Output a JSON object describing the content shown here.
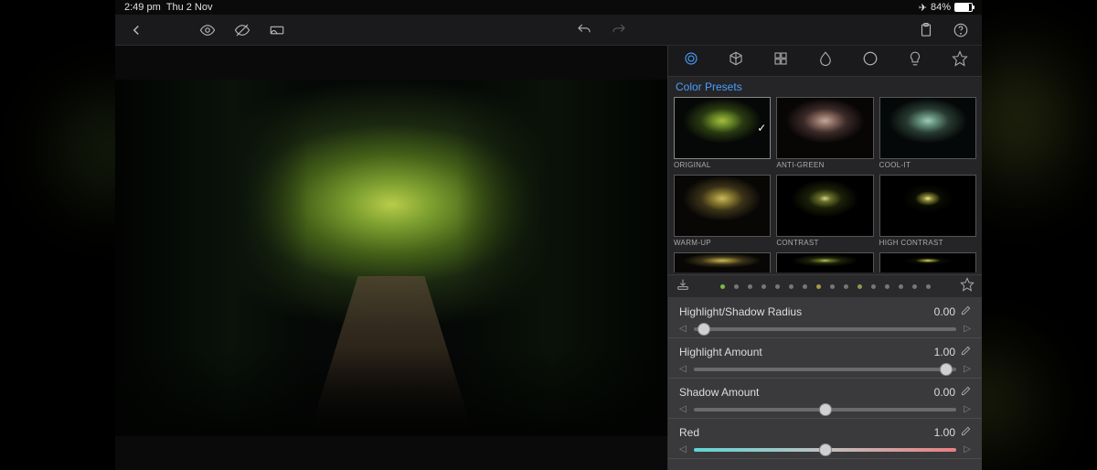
{
  "statusbar": {
    "time": "2:49 pm",
    "date": "Thu 2 Nov",
    "battery": "84%"
  },
  "panel": {
    "section_title": "Color Presets"
  },
  "presets": {
    "row1": [
      {
        "label": "ORIGINAL",
        "cls": "mini-orig",
        "selected": true
      },
      {
        "label": "ANTI-GREEN",
        "cls": "mini-antigreen"
      },
      {
        "label": "COOL-IT",
        "cls": "mini-coolit"
      }
    ],
    "row2": [
      {
        "label": "WARM-UP",
        "cls": "mini-warm"
      },
      {
        "label": "CONTRAST",
        "cls": "mini-contrast"
      },
      {
        "label": "HIGH CONTRAST",
        "cls": "mini-hicontrast"
      }
    ]
  },
  "dots": [
    "#7ab84a",
    "#777",
    "#777",
    "#777",
    "#777",
    "#777",
    "#777",
    "#a89a4a",
    "#777",
    "#777",
    "#8a9a4a",
    "#777",
    "#777",
    "#777",
    "#777",
    "#777"
  ],
  "sliders": [
    {
      "name": "Highlight/Shadow Radius",
      "val": "0.00",
      "pos": 0.04,
      "color": false
    },
    {
      "name": "Highlight Amount",
      "val": "1.00",
      "pos": 0.96,
      "color": false
    },
    {
      "name": "Shadow Amount",
      "val": "0.00",
      "pos": 0.5,
      "color": false
    },
    {
      "name": "Red",
      "val": "1.00",
      "pos": 0.5,
      "color": true
    }
  ]
}
